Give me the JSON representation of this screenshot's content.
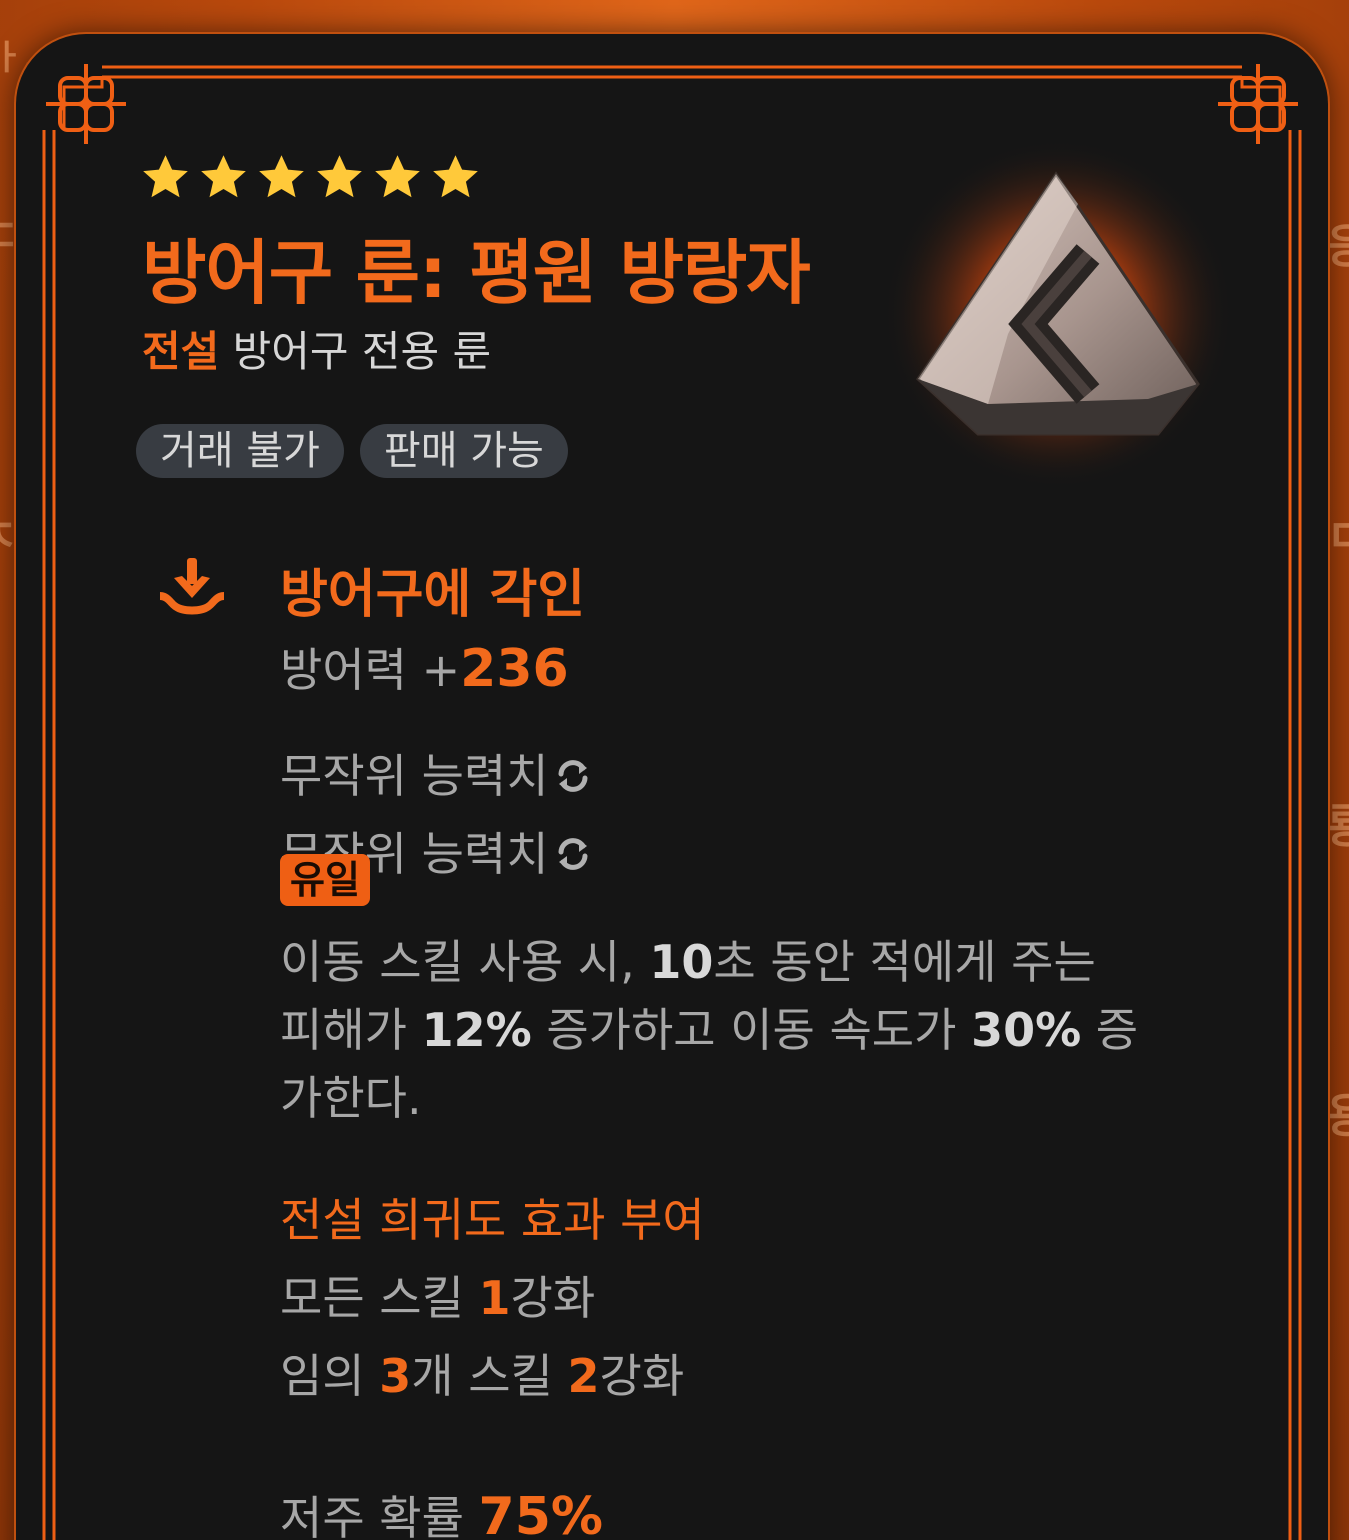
{
  "background": {
    "edge_glyphs_left": [
      "ㅏ.",
      "ㄷ",
      "ㅈ"
    ],
    "edge_glyphs_right": [
      "응",
      "ㅁ",
      "룡",
      "용"
    ]
  },
  "item": {
    "stars": 6,
    "name": "방어구 룬: 평원 방랑자",
    "rarity": "전설",
    "type": "방어구 전용 룬",
    "tags": [
      "거래 불가",
      "판매 가능"
    ],
    "image": "rune-stone-icon"
  },
  "engrave": {
    "icon": "download-icon",
    "title": "방어구에 각인",
    "defense_label": "방어력 +",
    "defense_value": "236",
    "random_stat_1": "무작위 능력치",
    "random_stat_2": "무작위 능력치",
    "unique_badge": "유일",
    "desc_1": "이동 스킬 사용 시, ",
    "desc_duration": "10",
    "desc_2": "초 동안 적에게 주는 피해가 ",
    "desc_damage": "12%",
    "desc_3": " 증가하고 이동 속도가 ",
    "desc_speed": "30%",
    "desc_4": " 증가한다."
  },
  "legend_effect": {
    "title": "전설 희귀도 효과 부여",
    "line1_pre": "모든 스킬 ",
    "line1_num": "1",
    "line1_post": "강화",
    "line2_pre": "임의 ",
    "line2_num1": "3",
    "line2_mid": "개 스킬 ",
    "line2_num2": "2",
    "line2_post": "강화"
  },
  "curse": {
    "label": "저주 확률 ",
    "value": "75%"
  },
  "colors": {
    "accent": "#f26a1c",
    "star": "#ffc93a",
    "card_bg": "#151515",
    "text": "#a7a7a7",
    "tag_bg": "#383c42"
  }
}
